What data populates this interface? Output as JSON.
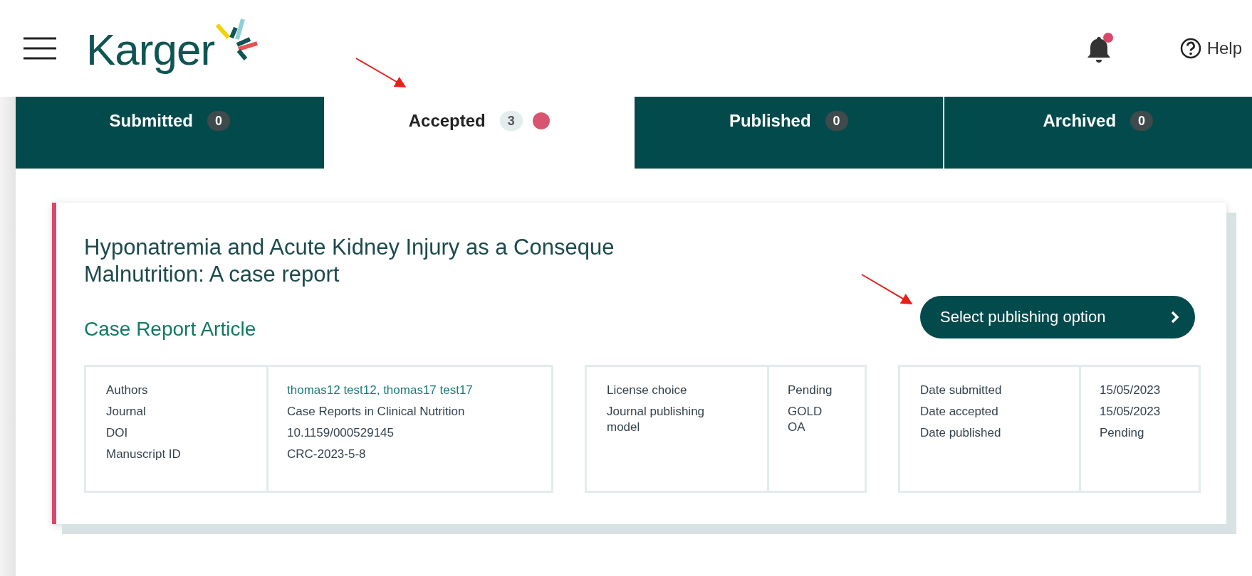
{
  "header": {
    "logo": "Karger",
    "notifications": {
      "has_unread": true
    },
    "help": "Help"
  },
  "tabs": [
    {
      "label": "Submitted",
      "count": "0",
      "selected": false,
      "has_alert": false
    },
    {
      "label": "Accepted",
      "count": "3",
      "selected": true,
      "has_alert": true
    },
    {
      "label": "Published",
      "count": "0",
      "selected": false,
      "has_alert": false
    },
    {
      "label": "Archived",
      "count": "0",
      "selected": false,
      "has_alert": false
    }
  ],
  "article": {
    "title_lines": [
      "Hyponatremia and Acute Kidney Injury as a Conseque",
      "Malnutrition: A case report"
    ],
    "type": "Case Report Article",
    "action": "Select publishing option",
    "tables": [
      {
        "labels": [
          "Authors",
          "Journal",
          "DOI",
          "Manuscript ID"
        ],
        "values": [
          {
            "kind": "link",
            "text": "thomas12 test12, thomas17 test17"
          },
          {
            "kind": "text",
            "text": "Case Reports in Clinical Nutrition"
          },
          {
            "kind": "text",
            "text": "10.1159/000529145"
          },
          {
            "kind": "text",
            "text": "CRC-2023-5-8"
          }
        ]
      },
      {
        "labels": [
          "License choice",
          "Journal publishing model"
        ],
        "values": [
          {
            "kind": "text",
            "text": "Pending"
          },
          {
            "kind": "text",
            "text": "GOLD OA"
          }
        ]
      },
      {
        "labels": [
          "Date submitted",
          "Date accepted",
          "Date published"
        ],
        "values": [
          {
            "kind": "text",
            "text": "15/05/2023"
          },
          {
            "kind": "text",
            "text": "15/05/2023"
          },
          {
            "kind": "text",
            "text": "Pending"
          }
        ]
      }
    ]
  }
}
